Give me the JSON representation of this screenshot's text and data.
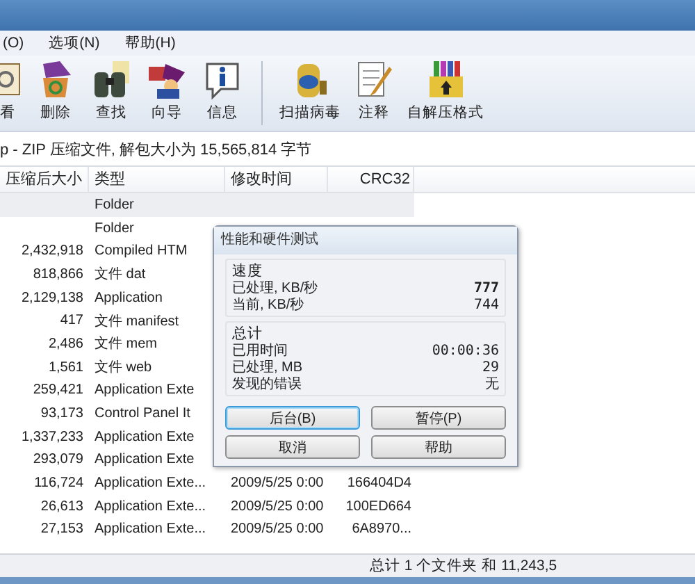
{
  "menu": [
    "(O)",
    "选项(N)",
    "帮助(H)"
  ],
  "toolbar": [
    {
      "label": "看"
    },
    {
      "label": "删除"
    },
    {
      "label": "查找"
    },
    {
      "label": "向导"
    },
    {
      "label": "信息"
    },
    {
      "label": "扫描病毒"
    },
    {
      "label": "注释"
    },
    {
      "label": "自解压格式"
    }
  ],
  "address": "p - ZIP 压缩文件, 解包大小为 15,565,814 字节",
  "table": {
    "columns": [
      "压缩后大小",
      "类型",
      "修改时间",
      "CRC32"
    ],
    "rows": [
      {
        "size": "",
        "type": "Folder",
        "time": "",
        "crc": "",
        "selected": true
      },
      {
        "size": "",
        "type": "Folder",
        "time": "",
        "crc": "",
        "selected": false
      },
      {
        "size": "2,432,918",
        "type": "Compiled HTM",
        "time": "",
        "crc": "",
        "selected": false
      },
      {
        "size": "818,866",
        "type": "文件 dat",
        "time": "",
        "crc": "",
        "selected": false
      },
      {
        "size": "2,129,138",
        "type": "Application",
        "time": "",
        "crc": "",
        "selected": false
      },
      {
        "size": "417",
        "type": "文件 manifest",
        "time": "",
        "crc": "",
        "selected": false
      },
      {
        "size": "2,486",
        "type": "文件 mem",
        "time": "",
        "crc": "",
        "selected": false
      },
      {
        "size": "1,561",
        "type": "文件 web",
        "time": "",
        "crc": "",
        "selected": false
      },
      {
        "size": "259,421",
        "type": "Application Exte",
        "time": "",
        "crc": "",
        "selected": false
      },
      {
        "size": "93,173",
        "type": "Control Panel It",
        "time": "",
        "crc": "",
        "selected": false
      },
      {
        "size": "1,337,233",
        "type": "Application Exte",
        "time": "",
        "crc": "",
        "selected": false
      },
      {
        "size": "293,079",
        "type": "Application Exte",
        "time": "",
        "crc": "",
        "selected": false
      },
      {
        "size": "116,724",
        "type": "Application Exte...",
        "time": "2009/5/25 0:00",
        "crc": "166404D4",
        "selected": false
      },
      {
        "size": "26,613",
        "type": "Application Exte...",
        "time": "2009/5/25 0:00",
        "crc": "100ED664",
        "selected": false
      },
      {
        "size": "27,153",
        "type": "Application Exte...",
        "time": "2009/5/25 0:00",
        "crc": "6A8970...",
        "selected": false
      }
    ]
  },
  "status_bar": "总计 1 个文件夹 和 11,243,5",
  "dialog": {
    "title": "性能和硬件测试",
    "groups": [
      {
        "title": "速度",
        "rows": [
          {
            "label": "已处理, KB/秒",
            "value": "777",
            "bold": true
          },
          {
            "label": "当前, KB/秒",
            "value": "744",
            "bold": false
          }
        ]
      },
      {
        "title": "总计",
        "rows": [
          {
            "label": "已用时间",
            "value": "00:00:36",
            "bold": false
          },
          {
            "label": "已处理, MB",
            "value": "29",
            "bold": false
          },
          {
            "label": "发现的错误",
            "value": "无",
            "bold": false
          }
        ]
      }
    ],
    "buttons": [
      {
        "label": "后台(B)",
        "focused": true
      },
      {
        "label": "暂停(P)",
        "focused": false
      },
      {
        "label": "取消",
        "focused": false
      },
      {
        "label": "帮助",
        "focused": false
      }
    ]
  }
}
